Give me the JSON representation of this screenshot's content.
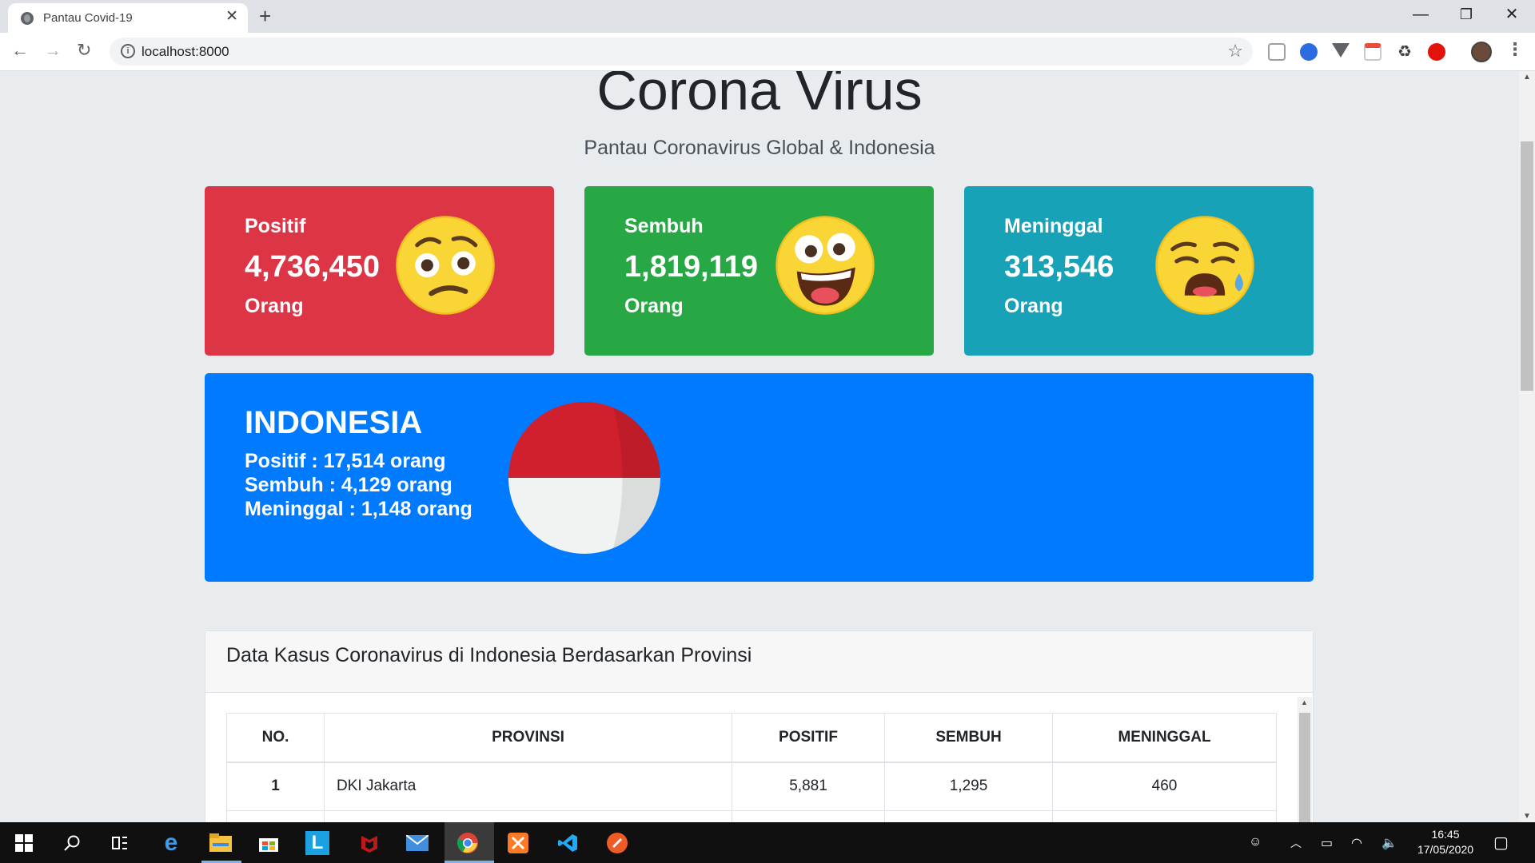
{
  "browser": {
    "tab_title": "Pantau Covid-19",
    "tab_close": "✕",
    "new_tab": "+",
    "url": "localhost:8000",
    "win_minimize": "—",
    "win_restore": "❐",
    "win_close": "✕",
    "back": "←",
    "forward": "→",
    "reload": "↻",
    "star": "☆",
    "menu": "⋮"
  },
  "hero": {
    "title": "Corona Virus",
    "subtitle": "Pantau Coronavirus Global & Indonesia"
  },
  "cards": [
    {
      "label": "Positif",
      "value": "4,736,450",
      "unit": "Orang",
      "emoji": "confused-face-icon",
      "color": "#dc3545"
    },
    {
      "label": "Sembuh",
      "value": "1,819,119",
      "unit": "Orang",
      "emoji": "grinning-face-icon",
      "color": "#28a745"
    },
    {
      "label": "Meninggal",
      "value": "313,546",
      "unit": "Orang",
      "emoji": "crying-face-icon",
      "color": "#17a2b8"
    }
  ],
  "indonesia": {
    "name": "INDONESIA",
    "positif": "Positif : 17,514 orang",
    "sembuh": "Sembuh : 4,129 orang",
    "meninggal": "Meninggal : 1,148 orang",
    "color": "#007bff"
  },
  "table": {
    "title": "Data Kasus Coronavirus di Indonesia Berdasarkan Provinsi",
    "headers": [
      "NO.",
      "PROVINSI",
      "POSITIF",
      "SEMBUH",
      "MENINGGAL"
    ],
    "rows": [
      {
        "no": "1",
        "provinsi": "DKI Jakarta",
        "positif": "5,881",
        "sembuh": "1,295",
        "meninggal": "460"
      }
    ]
  },
  "taskbar": {
    "time": "16:45",
    "date": "17/05/2020"
  }
}
